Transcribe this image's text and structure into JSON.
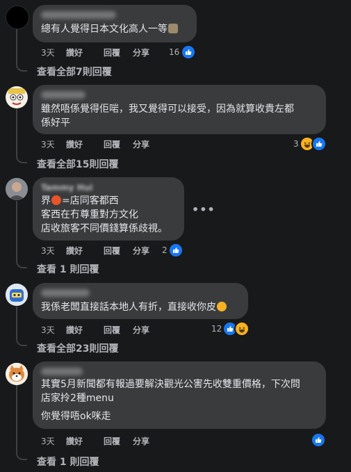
{
  "actions": {
    "like": "讚好",
    "reply": "回覆",
    "share": "分享"
  },
  "comments": [
    {
      "text": "總有人覺得日本文化高人一等",
      "time": "3天",
      "reaction_count": "16",
      "reactions": [
        "like"
      ],
      "view_replies": "查看全部7則回覆",
      "avatar": "black-circle"
    },
    {
      "text": "雖然唔係覺得佢啱，我又覺得可以接受，因為就算收貴左都\n係好平",
      "time": "3天",
      "reaction_count": "3",
      "reactions": [
        "haha",
        "like"
      ],
      "view_replies": "查看全部15則回覆",
      "avatar": "cartoon-face"
    },
    {
      "name_partial": "Tammy Hui",
      "line1_a": "界",
      "line1_b": "=店同客都西",
      "line2": "客西在冇尊重對方文化",
      "line3": "店收旅客不同價錢算係歧視。",
      "time": "3天",
      "reaction_count": "2",
      "reactions": [
        "like"
      ],
      "view_replies": "查看 1 則回覆",
      "more": "•••",
      "avatar": "photo-person"
    },
    {
      "text": "我係老闆直接話本地人有折，直接收你皮",
      "time": "3天",
      "reaction_count": "12",
      "reactions": [
        "like",
        "haha"
      ],
      "view_replies": "查看全部23則回覆",
      "avatar": "blue-character"
    },
    {
      "line1": "其實5月新聞都有報過要解決觀光公害先收雙重價格，下次問",
      "line2": "店家拎2種menu",
      "line3": "你覺得唔ok咪走",
      "time": "3天",
      "reaction_count": "",
      "reactions": [
        "like"
      ],
      "view_replies": "查看 1 則回覆",
      "avatar": "shiba-dog"
    }
  ],
  "colors": {
    "background": "#18191a",
    "bubble": "#3a3b3c",
    "text": "#e4e6eb",
    "secondary": "#b0b3b8",
    "like_blue": "#1877f2",
    "haha_yellow": "#f7b125"
  }
}
